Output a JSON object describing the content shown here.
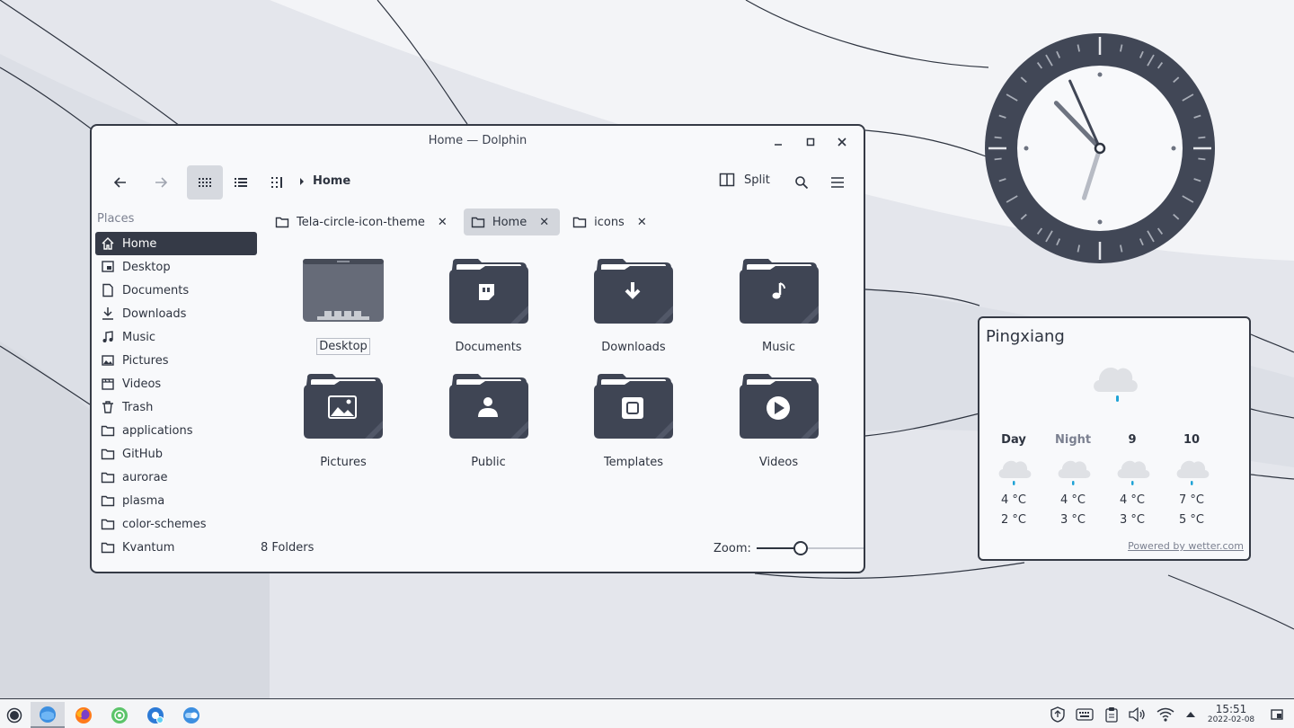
{
  "window": {
    "title": "Home — Dolphin",
    "breadcrumb": "Home",
    "split_label": "Split",
    "places_header": "Places",
    "places": [
      {
        "label": "Home",
        "icon": "home-icon",
        "selected": true
      },
      {
        "label": "Desktop",
        "icon": "desktop-icon"
      },
      {
        "label": "Documents",
        "icon": "document-icon"
      },
      {
        "label": "Downloads",
        "icon": "download-icon"
      },
      {
        "label": "Music",
        "icon": "music-icon"
      },
      {
        "label": "Pictures",
        "icon": "picture-icon"
      },
      {
        "label": "Videos",
        "icon": "video-icon"
      },
      {
        "label": "Trash",
        "icon": "trash-icon"
      },
      {
        "label": "applications",
        "icon": "folder-icon"
      },
      {
        "label": "GitHub",
        "icon": "folder-icon"
      },
      {
        "label": "aurorae",
        "icon": "folder-icon"
      },
      {
        "label": "plasma",
        "icon": "folder-icon"
      },
      {
        "label": "color-schemes",
        "icon": "folder-icon"
      },
      {
        "label": "Kvantum",
        "icon": "folder-icon"
      }
    ],
    "tabs": [
      {
        "label": "Tela-circle-icon-theme",
        "active": false
      },
      {
        "label": "Home",
        "active": true
      },
      {
        "label": "icons",
        "active": false
      }
    ],
    "items": [
      {
        "label": "Desktop",
        "emblem": "desktop"
      },
      {
        "label": "Documents",
        "emblem": "documents"
      },
      {
        "label": "Downloads",
        "emblem": "downloads"
      },
      {
        "label": "Music",
        "emblem": "music"
      },
      {
        "label": "Pictures",
        "emblem": "pictures"
      },
      {
        "label": "Public",
        "emblem": "public"
      },
      {
        "label": "Templates",
        "emblem": "templates"
      },
      {
        "label": "Videos",
        "emblem": "videos"
      }
    ],
    "status": "8 Folders",
    "zoom_label": "Zoom:",
    "zoom_level": 0.4
  },
  "weather": {
    "city": "Pingxiang",
    "forecast": [
      {
        "label": "Day",
        "high": "4 °C",
        "low": "2 °C",
        "dim": false
      },
      {
        "label": "Night",
        "high": "4 °C",
        "low": "3 °C",
        "dim": true
      },
      {
        "label": "9",
        "high": "4 °C",
        "low": "3 °C",
        "dim": false
      },
      {
        "label": "10",
        "high": "7 °C",
        "low": "5 °C",
        "dim": false
      }
    ],
    "credit": "Powered by wetter.com"
  },
  "analog_clock": {
    "hour": 10,
    "minute": 32,
    "second": 56
  },
  "taskbar": {
    "apps": [
      "launcher-icon",
      "dolphin-icon",
      "firefox-icon",
      "app-green-icon",
      "app-blue-icon",
      "app-toggle-icon"
    ],
    "time": "15:51",
    "date": "2022-02-08"
  },
  "colors": {
    "accent_dark": "#353a47",
    "folder": "#3f4554",
    "rain": "#1fa3d6"
  }
}
